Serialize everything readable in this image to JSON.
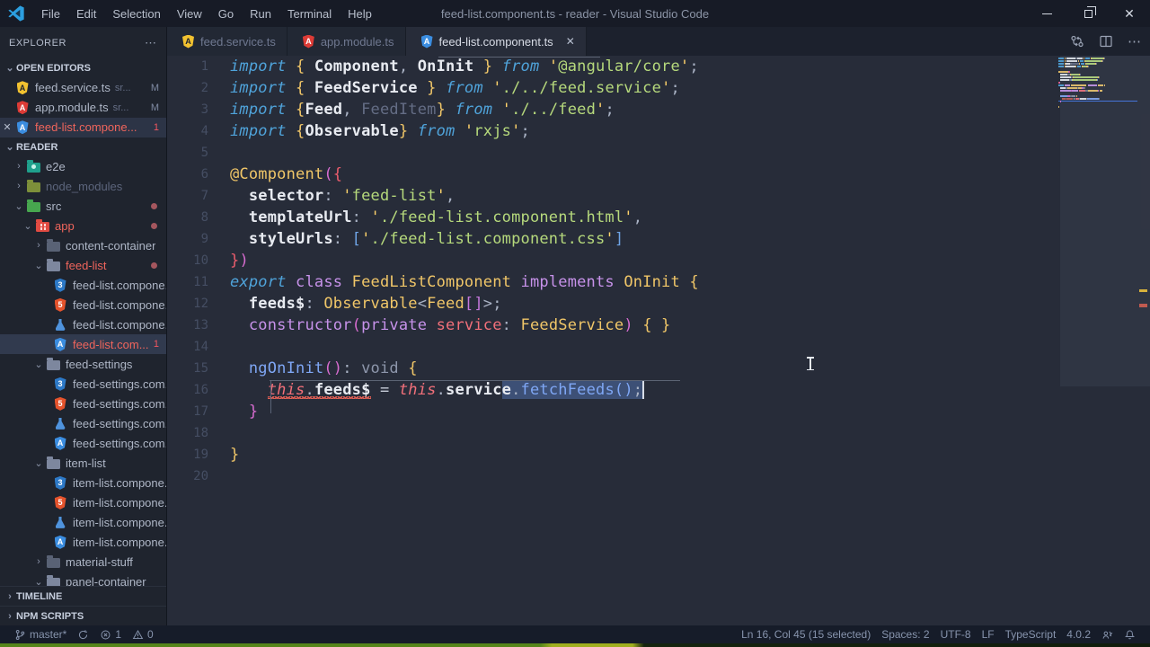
{
  "title_bar": {
    "menus": [
      "File",
      "Edit",
      "Selection",
      "View",
      "Go",
      "Run",
      "Terminal",
      "Help"
    ],
    "title": "feed-list.component.ts - reader - Visual Studio Code",
    "controls": [
      {
        "icon": "minimize-icon"
      },
      {
        "icon": "restore-icon"
      },
      {
        "icon": "close-icon"
      }
    ]
  },
  "tabs": [
    {
      "label": "feed.service.ts",
      "icon": "angular-yellow-icon",
      "active": false
    },
    {
      "label": "app.module.ts",
      "icon": "angular-red-icon",
      "active": false
    },
    {
      "label": "feed-list.component.ts",
      "icon": "angular-blue-icon",
      "active": true,
      "close_label": "✕"
    }
  ],
  "editor_actions": [
    {
      "icon": "open-changes-icon"
    },
    {
      "icon": "split-editor-icon"
    },
    {
      "icon": "more-actions-icon"
    }
  ],
  "explorer": {
    "header": "EXPLORER",
    "more_icon": "⋯",
    "open_editors": {
      "label": "OPEN EDITORS",
      "items": [
        {
          "icon": "angular-yellow-icon",
          "label": "feed.service.ts",
          "desc": "sr...",
          "badge": "M"
        },
        {
          "icon": "angular-red-icon",
          "label": "app.module.ts",
          "desc": "sr...",
          "badge": "M"
        },
        {
          "icon": "angular-blue-icon",
          "label": "feed-list.compone...",
          "badge": "1",
          "badge_error": true,
          "active": true,
          "error": true,
          "close": "✕"
        }
      ]
    },
    "tree": {
      "label": "READER",
      "items": [
        {
          "icon": "folder-e2e-icon",
          "label": "e2e",
          "level": 1,
          "chev": "closed"
        },
        {
          "icon": "folder-node-icon",
          "label": "node_modules",
          "level": 1,
          "chev": "closed",
          "dim": true
        },
        {
          "icon": "folder-src-icon",
          "label": "src",
          "level": 1,
          "chev": "open",
          "dot": true
        },
        {
          "icon": "folder-app-icon",
          "label": "app",
          "level": 2,
          "chev": "open",
          "dot": true,
          "error": true
        },
        {
          "icon": "folder-icon",
          "label": "content-container",
          "level": 3,
          "chev": "closed"
        },
        {
          "icon": "folder-open-icon",
          "label": "feed-list",
          "level": 3,
          "chev": "open",
          "dot": true,
          "error": true
        },
        {
          "icon": "css3-icon",
          "label": "feed-list.compone...",
          "level": 4
        },
        {
          "icon": "html5-icon",
          "label": "feed-list.compone...",
          "level": 4
        },
        {
          "icon": "test-icon",
          "label": "feed-list.compone...",
          "level": 4
        },
        {
          "icon": "angular-blue-icon",
          "label": "feed-list.com...",
          "level": 4,
          "badge": "1",
          "badge_error": true,
          "error": true,
          "selected": true
        },
        {
          "icon": "folder-open-icon",
          "label": "feed-settings",
          "level": 3,
          "chev": "open"
        },
        {
          "icon": "css3-icon",
          "label": "feed-settings.com...",
          "level": 4
        },
        {
          "icon": "html5-icon",
          "label": "feed-settings.com...",
          "level": 4
        },
        {
          "icon": "test-icon",
          "label": "feed-settings.com...",
          "level": 4
        },
        {
          "icon": "angular-blue-icon",
          "label": "feed-settings.com...",
          "level": 4
        },
        {
          "icon": "folder-open-icon",
          "label": "item-list",
          "level": 3,
          "chev": "open"
        },
        {
          "icon": "css3-icon",
          "label": "item-list.compone...",
          "level": 4
        },
        {
          "icon": "html5-icon",
          "label": "item-list.compone...",
          "level": 4
        },
        {
          "icon": "test-icon",
          "label": "item-list.compone...",
          "level": 4
        },
        {
          "icon": "angular-blue-icon",
          "label": "item-list.compone...",
          "level": 4
        },
        {
          "icon": "folder-icon",
          "label": "material-stuff",
          "level": 3,
          "chev": "closed"
        },
        {
          "icon": "folder-open-icon",
          "label": "panel-container",
          "level": 3,
          "chev": "open"
        }
      ]
    },
    "bottom_sections": [
      {
        "label": "TIMELINE",
        "chev": "closed"
      },
      {
        "label": "NPM SCRIPTS",
        "chev": "closed"
      }
    ]
  },
  "code": {
    "lines": [
      {
        "n": 1,
        "t": [
          [
            "kb",
            "import"
          ],
          [
            "p",
            " "
          ],
          [
            "bg",
            "{"
          ],
          [
            "p",
            " "
          ],
          [
            "w",
            "Component"
          ],
          [
            "p",
            ", "
          ],
          [
            "w",
            "OnInit"
          ],
          [
            "p",
            " "
          ],
          [
            "bg",
            "}"
          ],
          [
            "p",
            " "
          ],
          [
            "kb",
            "from"
          ],
          [
            "p",
            " "
          ],
          [
            "q",
            "'"
          ],
          [
            "s",
            "@angular/core"
          ],
          [
            "q",
            "'"
          ],
          [
            "p",
            ";"
          ]
        ]
      },
      {
        "n": 2,
        "t": [
          [
            "kb",
            "import"
          ],
          [
            "p",
            " "
          ],
          [
            "bg",
            "{"
          ],
          [
            "p",
            " "
          ],
          [
            "w",
            "FeedService"
          ],
          [
            "p",
            " "
          ],
          [
            "bg",
            "}"
          ],
          [
            "p",
            " "
          ],
          [
            "kb",
            "from"
          ],
          [
            "p",
            " "
          ],
          [
            "q",
            "'"
          ],
          [
            "s",
            "./../feed.service"
          ],
          [
            "q",
            "'"
          ],
          [
            "p",
            ";"
          ]
        ]
      },
      {
        "n": 3,
        "t": [
          [
            "kb",
            "import"
          ],
          [
            "p",
            " "
          ],
          [
            "bg",
            "{"
          ],
          [
            "w",
            "Feed"
          ],
          [
            "p",
            ", "
          ],
          [
            "dim",
            "FeedItem"
          ],
          [
            "bg",
            "}"
          ],
          [
            "p",
            " "
          ],
          [
            "kb",
            "from"
          ],
          [
            "p",
            " "
          ],
          [
            "q",
            "'"
          ],
          [
            "s",
            "./../feed"
          ],
          [
            "q",
            "'"
          ],
          [
            "p",
            ";"
          ]
        ]
      },
      {
        "n": 4,
        "t": [
          [
            "kb",
            "import"
          ],
          [
            "p",
            " "
          ],
          [
            "bg",
            "{"
          ],
          [
            "w",
            "Observable"
          ],
          [
            "bg",
            "}"
          ],
          [
            "p",
            " "
          ],
          [
            "kb",
            "from"
          ],
          [
            "p",
            " "
          ],
          [
            "q",
            "'"
          ],
          [
            "s",
            "rxjs"
          ],
          [
            "q",
            "'"
          ],
          [
            "p",
            ";"
          ]
        ]
      },
      {
        "n": 5,
        "t": []
      },
      {
        "n": 6,
        "t": [
          [
            "ty",
            "@Component"
          ],
          [
            "bm",
            "("
          ],
          [
            "br",
            "{"
          ]
        ]
      },
      {
        "n": 7,
        "t": [
          [
            "p",
            "  "
          ],
          [
            "w",
            "selector"
          ],
          [
            "p",
            ": "
          ],
          [
            "q",
            "'"
          ],
          [
            "s",
            "feed-list"
          ],
          [
            "q",
            "'"
          ],
          [
            "p",
            ","
          ]
        ]
      },
      {
        "n": 8,
        "t": [
          [
            "p",
            "  "
          ],
          [
            "w",
            "templateUrl"
          ],
          [
            "p",
            ": "
          ],
          [
            "q",
            "'"
          ],
          [
            "s",
            "./feed-list.component.html"
          ],
          [
            "q",
            "'"
          ],
          [
            "p",
            ","
          ]
        ]
      },
      {
        "n": 9,
        "t": [
          [
            "p",
            "  "
          ],
          [
            "w",
            "styleUrls"
          ],
          [
            "p",
            ": "
          ],
          [
            "bb",
            "["
          ],
          [
            "q",
            "'"
          ],
          [
            "s",
            "./feed-list.component.css"
          ],
          [
            "q",
            "'"
          ],
          [
            "bb",
            "]"
          ]
        ]
      },
      {
        "n": 10,
        "t": [
          [
            "br",
            "}"
          ],
          [
            "bm",
            ")"
          ]
        ]
      },
      {
        "n": 11,
        "t": [
          [
            "kb",
            "export"
          ],
          [
            "p",
            " "
          ],
          [
            "kp",
            "class"
          ],
          [
            "p",
            " "
          ],
          [
            "ty",
            "FeedListComponent"
          ],
          [
            "p",
            " "
          ],
          [
            "kp",
            "implements"
          ],
          [
            "p",
            " "
          ],
          [
            "ty",
            "OnInit"
          ],
          [
            "p",
            " "
          ],
          [
            "bg",
            "{"
          ]
        ]
      },
      {
        "n": 12,
        "t": [
          [
            "p",
            "  "
          ],
          [
            "w",
            "feeds$"
          ],
          [
            "p",
            ": "
          ],
          [
            "ty",
            "Observable"
          ],
          [
            "p",
            "<"
          ],
          [
            "ty",
            "Feed"
          ],
          [
            "bp",
            "[]"
          ],
          [
            "p",
            ">;"
          ]
        ]
      },
      {
        "n": 13,
        "t": [
          [
            "p",
            "  "
          ],
          [
            "kp",
            "constructor"
          ],
          [
            "bm",
            "("
          ],
          [
            "kp",
            "private"
          ],
          [
            "p",
            " "
          ],
          [
            "pr",
            "service"
          ],
          [
            "p",
            ": "
          ],
          [
            "ty",
            "FeedService"
          ],
          [
            "bm",
            ")"
          ],
          [
            "p",
            " "
          ],
          [
            "bg",
            "{ }"
          ]
        ]
      },
      {
        "n": 14,
        "t": []
      },
      {
        "n": 15,
        "t": [
          [
            "p",
            "  "
          ],
          [
            "fn",
            "ngOnInit"
          ],
          [
            "bm",
            "()"
          ],
          [
            "p",
            ": "
          ],
          [
            "vd",
            "void"
          ],
          [
            "p",
            " "
          ],
          [
            "bg",
            "{"
          ]
        ]
      },
      {
        "n": 16,
        "t": [
          [
            "p",
            "    "
          ],
          [
            "th",
            "this",
            "sq"
          ],
          [
            "p",
            ".",
            "sq"
          ],
          [
            "w",
            "feeds$",
            "sq"
          ],
          [
            "p",
            " "
          ],
          [
            "op",
            "="
          ],
          [
            "p",
            " "
          ],
          [
            "th",
            "this"
          ],
          [
            "p",
            "."
          ],
          [
            "w",
            "servic"
          ],
          [
            "w",
            "e",
            "sel"
          ],
          [
            "p",
            ".",
            "sel"
          ],
          [
            "fn",
            "fetchFeeds",
            "sel"
          ],
          [
            "fn",
            "()",
            "sel"
          ],
          [
            "p",
            ";",
            "sel"
          ],
          [
            "cur",
            ""
          ]
        ]
      },
      {
        "n": 17,
        "t": [
          [
            "p",
            "  "
          ],
          [
            "bm",
            "}"
          ]
        ]
      },
      {
        "n": 18,
        "t": []
      },
      {
        "n": 19,
        "t": [
          [
            "bg",
            "}"
          ]
        ]
      },
      {
        "n": 20,
        "t": []
      }
    ]
  },
  "status_bar": {
    "left": [
      {
        "icon": "git-branch-icon",
        "label": "master*"
      },
      {
        "icon": "sync-icon",
        "label": ""
      },
      {
        "icon": "error-icon",
        "label": "1"
      },
      {
        "icon": "warning-icon",
        "label": "0"
      }
    ],
    "right": [
      {
        "label": "Ln 16, Col 45 (15 selected)"
      },
      {
        "label": "Spaces: 2"
      },
      {
        "label": "UTF-8"
      },
      {
        "label": "LF"
      },
      {
        "label": "TypeScript"
      },
      {
        "label": "4.0.2"
      },
      {
        "icon": "feedback-icon",
        "label": ""
      },
      {
        "icon": "bell-icon",
        "label": ""
      }
    ]
  },
  "colors": {
    "editor_bg": "#272c39",
    "sidebar_bg": "#1f242e",
    "titlebar_bg": "#171b26",
    "statusbar_bg": "#161c29",
    "selection_bg": "#3d5076",
    "error_red": "#f0565f",
    "modified_dot": "#a4565e",
    "angular_yellow": "#f2c230",
    "angular_red": "#dd3b36",
    "angular_blue": "#3b8de0",
    "css_blue": "#2d79c7",
    "html_orange": "#e5532c",
    "test_blue": "#4f93dd",
    "folder_gray": "#6d7690",
    "folder_e2e": "#1fa08c",
    "folder_node": "#7d8f3a",
    "folder_src": "#47a64f",
    "folder_app": "#e14b42",
    "token_colors": {
      "p": "#aab3c5",
      "w": "#e8ebf1",
      "kb": "#4fa3da",
      "kp": "#c792ea",
      "ty": "#f0c668",
      "dim": "#646d85",
      "s": "#b6d97c",
      "q": "#ffd36b",
      "th": "#f2707a",
      "pr": "#f2707a",
      "fn": "#7fa7f5",
      "vd": "#8d96ab",
      "bg": "#f0c668",
      "bm": "#d76cd0",
      "br": "#ec5d6d",
      "bb": "#6fa5e6",
      "bp": "#c678dd",
      "op": "#c7cdd9"
    }
  }
}
